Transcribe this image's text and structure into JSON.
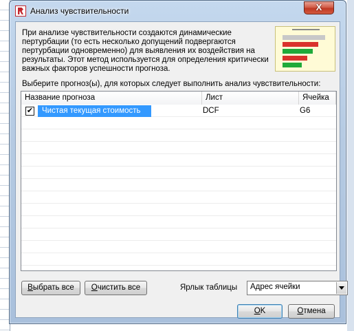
{
  "window": {
    "title": "Анализ чувствительности",
    "close_glyph": "X"
  },
  "description": "При анализе чувствительности создаются динамические пертурбации (то есть несколько допущений подвергаются пертурбации одновременно) для выявления их воздействия на результаты. Этот метод используется для определения критически важных факторов успешности прогноза.",
  "preview_icon": "tornado-chart-thumbnail",
  "prompt": "Выберите прогноз(ы), для которых следует выполнить анализ чувствительности:",
  "table": {
    "columns": [
      "Название прогноза",
      "Лист",
      "Ячейка"
    ],
    "rows": [
      {
        "checked": true,
        "check_glyph": "✔",
        "name": "Чистая текущая стоимость",
        "sheet": "DCF",
        "cell": "G6"
      }
    ]
  },
  "buttons": {
    "select_all_hotkey": "В",
    "select_all_rest": "ыбрать все",
    "clear_all_hotkey": "О",
    "clear_all_rest": "чистить все",
    "ok_hotkey": "O",
    "ok_rest": "K",
    "cancel_hotkey": "О",
    "cancel_rest": "тмена"
  },
  "table_label": {
    "label": "Ярлык таблицы",
    "value": "Адрес ячейки"
  },
  "colors": {
    "selection": "#3399ff",
    "close": "#c03823",
    "brand": "#c2272d"
  }
}
